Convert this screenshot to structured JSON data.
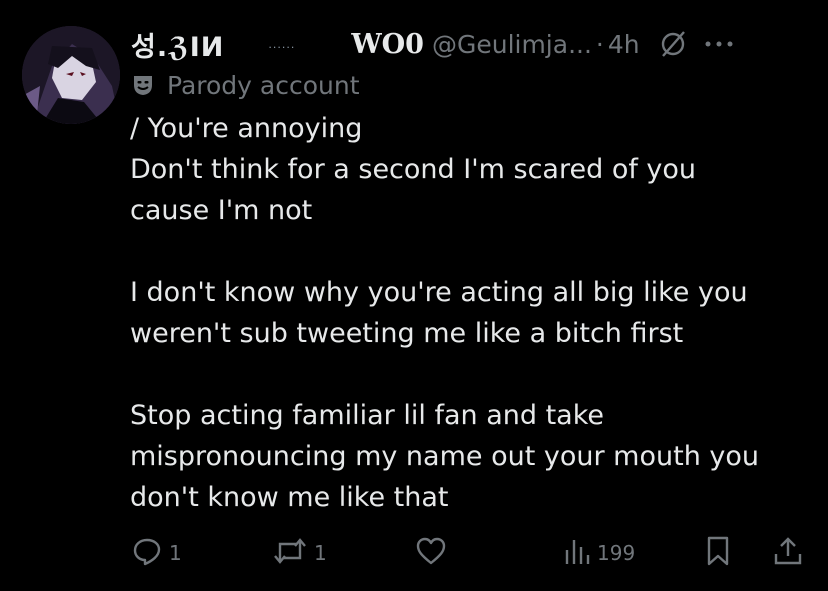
{
  "tweet": {
    "display_name": "성.ℨIИ",
    "name_dots": "......",
    "name_suffix": "WO0",
    "handle": "@Geulimja...",
    "separator": "·",
    "time": "4h",
    "parody_label": "Parody account",
    "text": "/ You're annoying\nDon't think for a second I'm scared of you\ncause I'm not\n\nI don't know why you're acting all big like you\nweren't sub tweeting me like a bitch first\n\nStop acting familiar lil fan and take\nmispronouncing my name out your mouth you\ndon't know me like that"
  },
  "actions": {
    "reply_count": "1",
    "retweet_count": "1",
    "like_count": "",
    "views_count": "199"
  },
  "icons": {
    "avatar": "avatar-image",
    "grok": "grok-icon",
    "more": "more-icon",
    "parody": "parody-mask-icon",
    "reply": "reply-icon",
    "retweet": "retweet-icon",
    "like": "heart-icon",
    "views": "views-icon",
    "bookmark": "bookmark-icon",
    "share": "share-icon"
  },
  "colors": {
    "background": "#000000",
    "text": "#e7e9ea",
    "muted": "#71767b"
  }
}
